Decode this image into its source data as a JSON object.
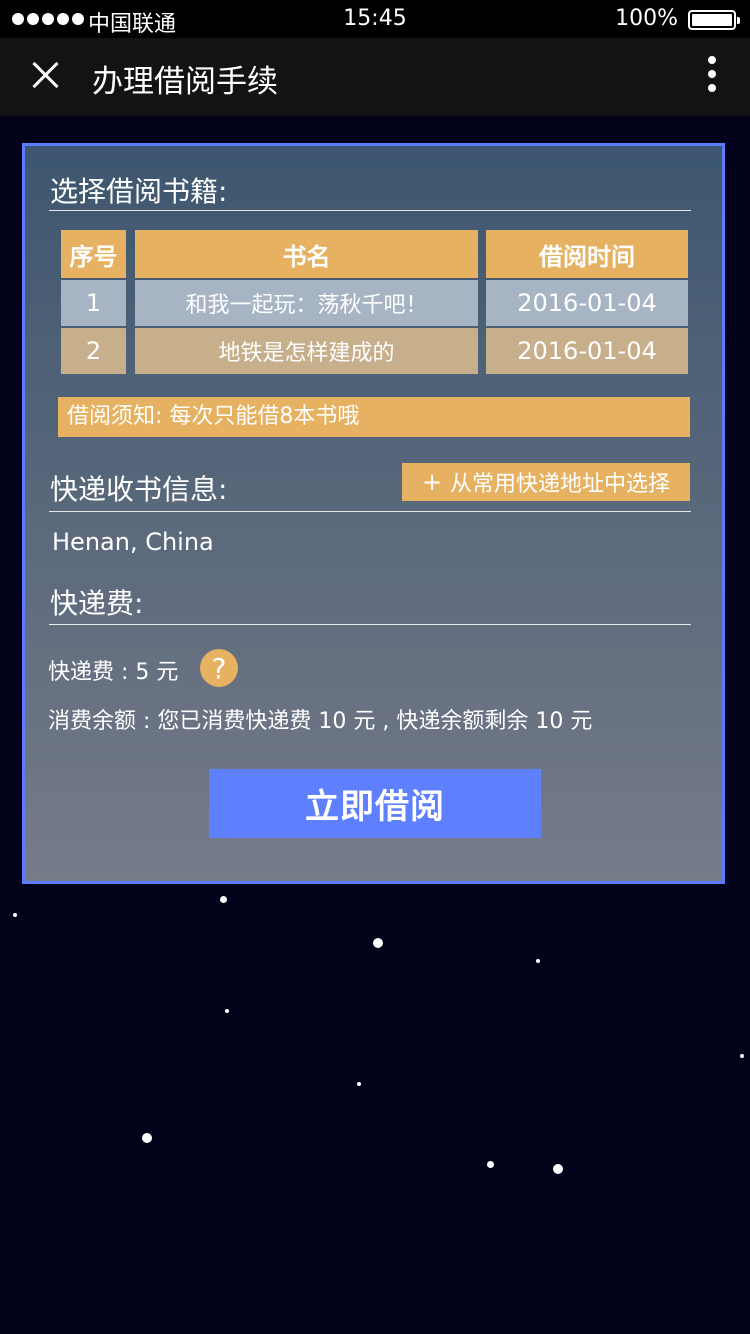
{
  "status_bar": {
    "carrier": "中国联通",
    "time": "15:45",
    "battery": "100%"
  },
  "nav": {
    "title": "办理借阅手续"
  },
  "books_section": {
    "title": "选择借阅书籍:",
    "headers": [
      "序号",
      "书名",
      "借阅时间"
    ],
    "rows": [
      {
        "index": "1",
        "title": "和我一起玩：荡秋千吧！",
        "date": "2016-01-04"
      },
      {
        "index": "2",
        "title": "地铁是怎样建成的",
        "date": "2016-01-04"
      }
    ]
  },
  "notice": "借阅须知: 每次只能借8本书哦",
  "delivery_section": {
    "title": "快递收书信息:",
    "pick_button": "从常用快递地址中选择",
    "address": "Henan, China"
  },
  "fee_section": {
    "title": "快递费:",
    "fee_line": "快递费 : 5 元",
    "balance_line": "消费余额 : 您已消费快递费 10 元 , 快递余额剩余 10 元",
    "help_symbol": "?"
  },
  "borrow_button": "立即借阅",
  "colors": {
    "accent_orange": "#e7b162",
    "primary_blue": "#5e80ff",
    "panel_border": "#5d7bff",
    "background": "#02021a"
  },
  "icons": [
    "close-icon",
    "more-icon",
    "plus-icon",
    "help-icon"
  ]
}
